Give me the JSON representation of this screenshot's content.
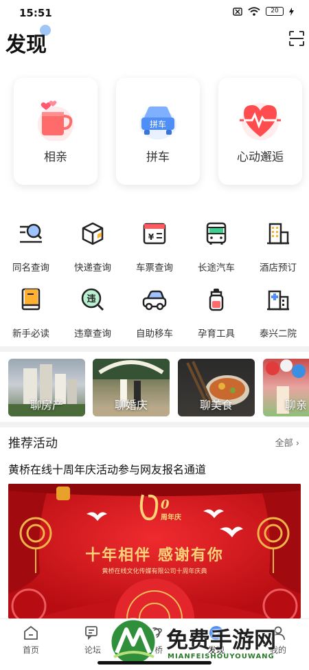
{
  "status_bar": {
    "time": "15:51",
    "battery": "20"
  },
  "header": {
    "title": "发现"
  },
  "featured": [
    {
      "label": "相亲",
      "icon": "coffee-heart-icon"
    },
    {
      "label": "拼车",
      "icon": "carpool-icon",
      "icon_text": "拼车"
    },
    {
      "label": "心动邂逅",
      "icon": "heartbeat-icon"
    }
  ],
  "services": [
    {
      "label": "同名查询",
      "icon": "name-search-icon"
    },
    {
      "label": "快递查询",
      "icon": "package-icon"
    },
    {
      "label": "车票查询",
      "icon": "ticket-icon"
    },
    {
      "label": "长途汽车",
      "icon": "bus-icon"
    },
    {
      "label": "酒店预订",
      "icon": "hotel-icon"
    },
    {
      "label": "新手必读",
      "icon": "book-icon"
    },
    {
      "label": "违章查询",
      "icon": "violation-icon",
      "icon_text": "违"
    },
    {
      "label": "自助移车",
      "icon": "car-icon"
    },
    {
      "label": "孕育工具",
      "icon": "baby-bottle-icon"
    },
    {
      "label": "泰兴二院",
      "icon": "hospital-icon"
    }
  ],
  "topics": [
    {
      "label": "聊房产"
    },
    {
      "label": "聊婚庆"
    },
    {
      "label": "聊美食"
    },
    {
      "label": "聊亲"
    }
  ],
  "recommend": {
    "title": "推荐活动",
    "more": "全部",
    "activity_title": "黄桥在线十周年庆活动参与网友报名通道",
    "banner": {
      "slogan": "十年相伴  感谢有你",
      "subtitle": "黄桥在线文化传媒有限公司十周年庆典",
      "anniversary": "周年庆"
    }
  },
  "tabbar": [
    {
      "label": "首页",
      "icon": "home-icon"
    },
    {
      "label": "论坛",
      "icon": "forum-icon"
    },
    {
      "label": "黄桥",
      "icon": "planet-icon"
    },
    {
      "label": "发现",
      "icon": "discover-icon",
      "active": true
    },
    {
      "label": "我的",
      "icon": "profile-icon"
    }
  ],
  "watermark": {
    "text": "免费手游网",
    "sub": "MIANFEISHOUYOUWANG"
  },
  "colors": {
    "accent_red": "#ff4d4f",
    "accent_blue": "#4f8ef7",
    "banner_red": "#d6161c",
    "gold": "#ffd27a"
  }
}
